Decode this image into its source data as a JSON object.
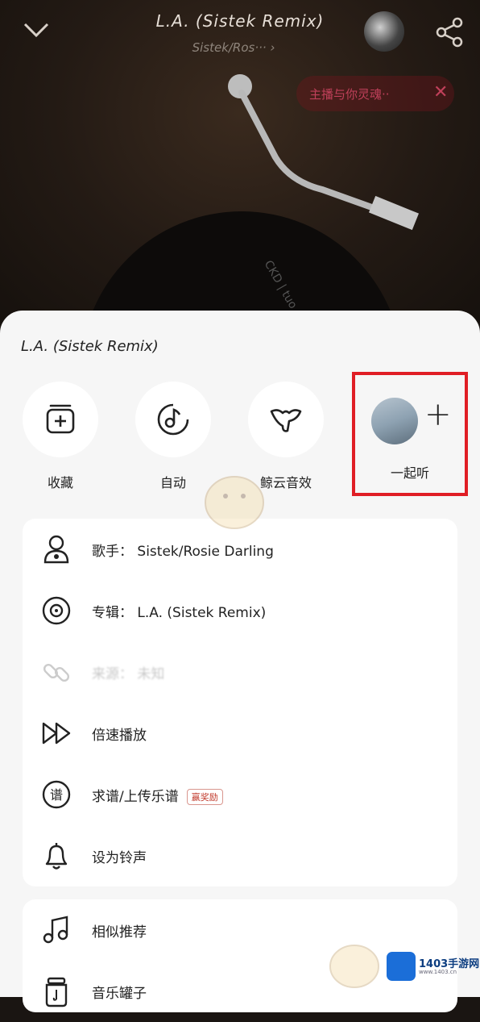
{
  "header": {
    "song_title": "L.A. (Sistek Remix)",
    "song_artist": "Sistek/Ros··· ›",
    "live_text": "主播与你灵魂··",
    "live_close": "✕"
  },
  "disc_text": "CKD | tuo",
  "sheet": {
    "title": "L.A. (Sistek Remix)",
    "actions": [
      {
        "label": "收藏",
        "icon": "collect-add-icon"
      },
      {
        "label": "自动",
        "icon": "auto-music-icon"
      },
      {
        "label": "鲸云音效",
        "icon": "whale-sound-icon"
      }
    ],
    "together": {
      "label": "一起听",
      "plus": "+"
    }
  },
  "menu_main": [
    {
      "text": "歌手： Sistek/Rosie Darling",
      "icon": "singer-icon"
    },
    {
      "text": "专辑： L.A. (Sistek Remix)",
      "icon": "album-icon"
    },
    {
      "text": "来源： 未知",
      "icon": "link-icon",
      "dim": true
    },
    {
      "text": "倍速播放",
      "icon": "speed-icon"
    },
    {
      "text": "求谱/上传乐谱",
      "icon": "score-icon",
      "badge": "赢奖励"
    },
    {
      "text": "设为铃声",
      "icon": "bell-icon"
    }
  ],
  "menu_secondary": [
    {
      "text": "相似推荐",
      "icon": "similar-icon"
    },
    {
      "text": "音乐罐子",
      "icon": "jar-icon"
    }
  ],
  "watermark": {
    "brand": "1403手游网",
    "sub": "www.1403.cn"
  }
}
